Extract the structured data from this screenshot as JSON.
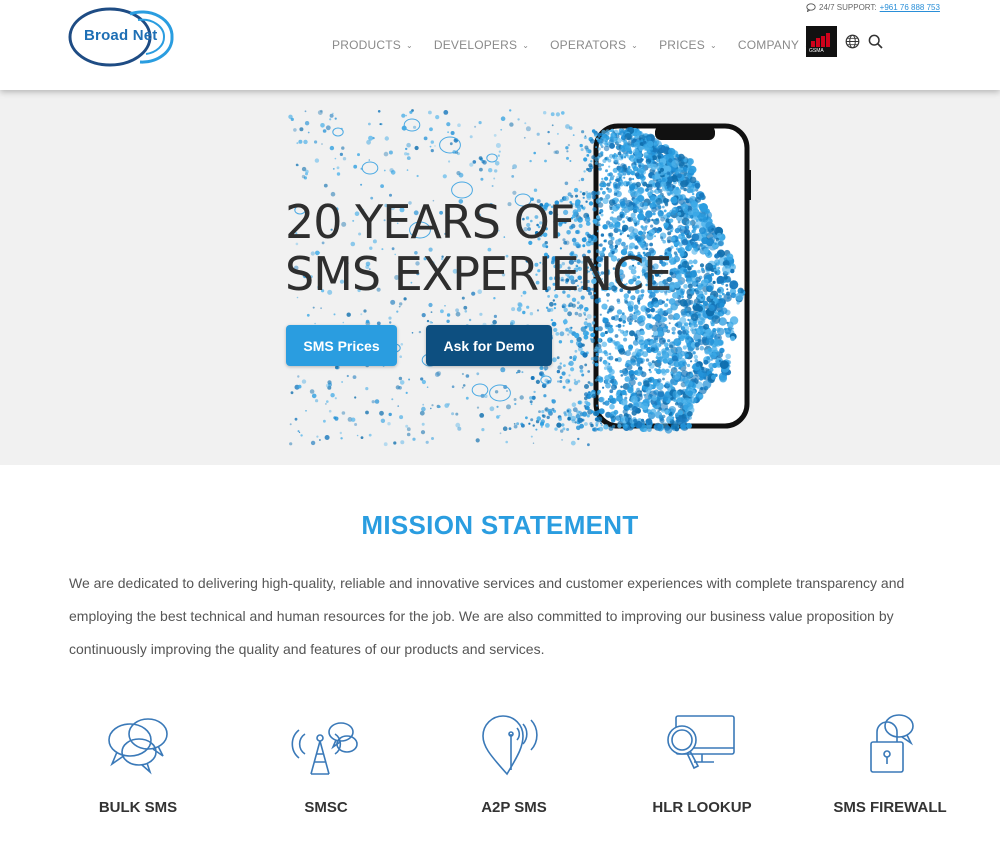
{
  "header": {
    "logo_text": "Broad Net",
    "support_label": "24/7 SUPPORT:",
    "support_phone": "+961 76 888 753",
    "nav": [
      {
        "label": "PRODUCTS"
      },
      {
        "label": "DEVELOPERS"
      },
      {
        "label": "OPERATORS"
      },
      {
        "label": "PRICES"
      },
      {
        "label": "COMPANY"
      }
    ],
    "gsma_label": "GSMA"
  },
  "hero": {
    "title_line1": "20 YEARS OF",
    "title_line2": "SMS EXPERIENCE",
    "primary_button": "SMS Prices",
    "secondary_button": "Ask for Demo"
  },
  "mission": {
    "title": "MISSION STATEMENT",
    "text": "We are dedicated to delivering high-quality, reliable and innovative services and customer experiences with complete transparency and employing the best technical and human resources for the job. We are also committed to improving our business value proposition by continuously improving the quality and features of our products and services."
  },
  "services": [
    {
      "label": "BULK SMS",
      "icon": "chat-bubbles-icon"
    },
    {
      "label": "SMSC",
      "icon": "antenna-tower-icon"
    },
    {
      "label": "A2P SMS",
      "icon": "location-signal-icon"
    },
    {
      "label": "HLR LOOKUP",
      "icon": "monitor-magnifier-icon"
    },
    {
      "label": "SMS FIREWALL",
      "icon": "padlock-chat-icon"
    }
  ],
  "colors": {
    "accent": "#2a9de0",
    "dark_blue": "#0d4f80",
    "icon_stroke": "#3a79b8"
  }
}
